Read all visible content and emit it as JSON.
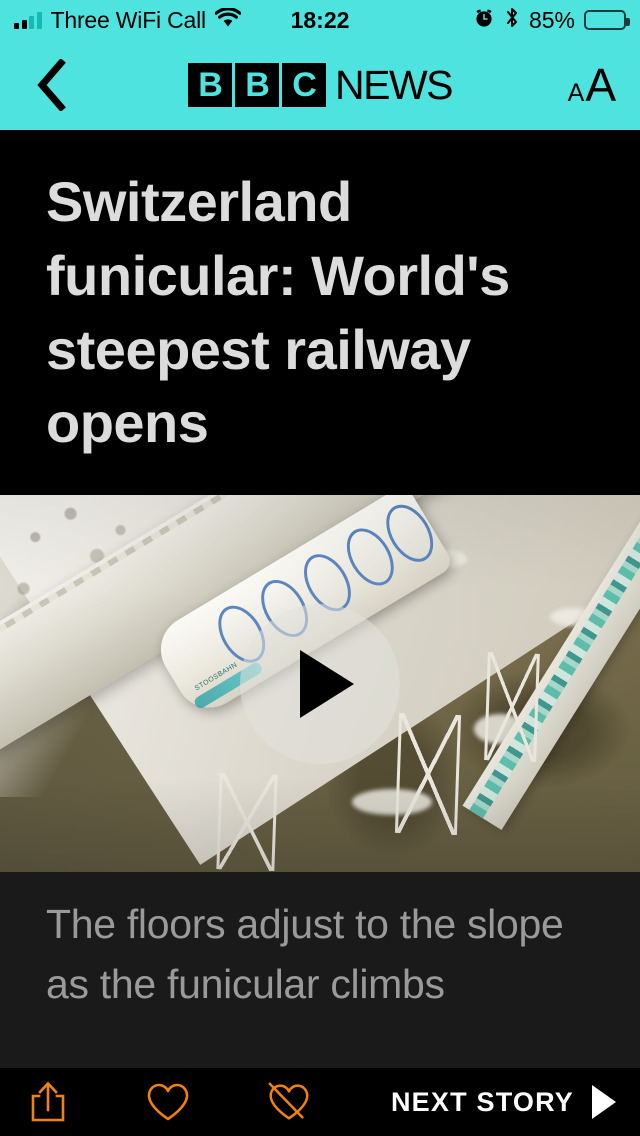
{
  "status_bar": {
    "carrier": "Three WiFi Call",
    "time": "18:22",
    "battery_percent": "85%",
    "icons": {
      "signal": "signal-bars-icon",
      "wifi": "wifi-icon",
      "alarm": "alarm-clock-icon",
      "bluetooth": "bluetooth-icon",
      "battery": "battery-icon"
    },
    "background_color": "#4fe3e0",
    "foreground_color": "#000000"
  },
  "nav": {
    "back_icon": "chevron-left-icon",
    "logo_blocks": [
      "B",
      "B",
      "C"
    ],
    "logo_word": "NEWS",
    "text_size_small": "A",
    "text_size_large": "A",
    "background_color": "#4fe3e0"
  },
  "article": {
    "headline": "Switzerland funicular: World's steepest railway opens",
    "headline_color": "#dcdcdc",
    "caption": "The floors adjust to the slope as the funicular climbs",
    "caption_color": "#9a9a9a",
    "media": {
      "type": "video-thumbnail",
      "play_icon": "play-triangle-icon",
      "alt": "Aerial view of a white funicular train climbing a steep snowy mountainside viaduct"
    }
  },
  "toolbar": {
    "share_icon": "share-icon",
    "like_icon": "heart-icon",
    "dislike_icon": "heart-crossed-icon",
    "next_label": "NEXT STORY",
    "next_arrow_icon": "play-arrow-icon",
    "icon_color": "#f0820f",
    "background_color": "#000000"
  }
}
